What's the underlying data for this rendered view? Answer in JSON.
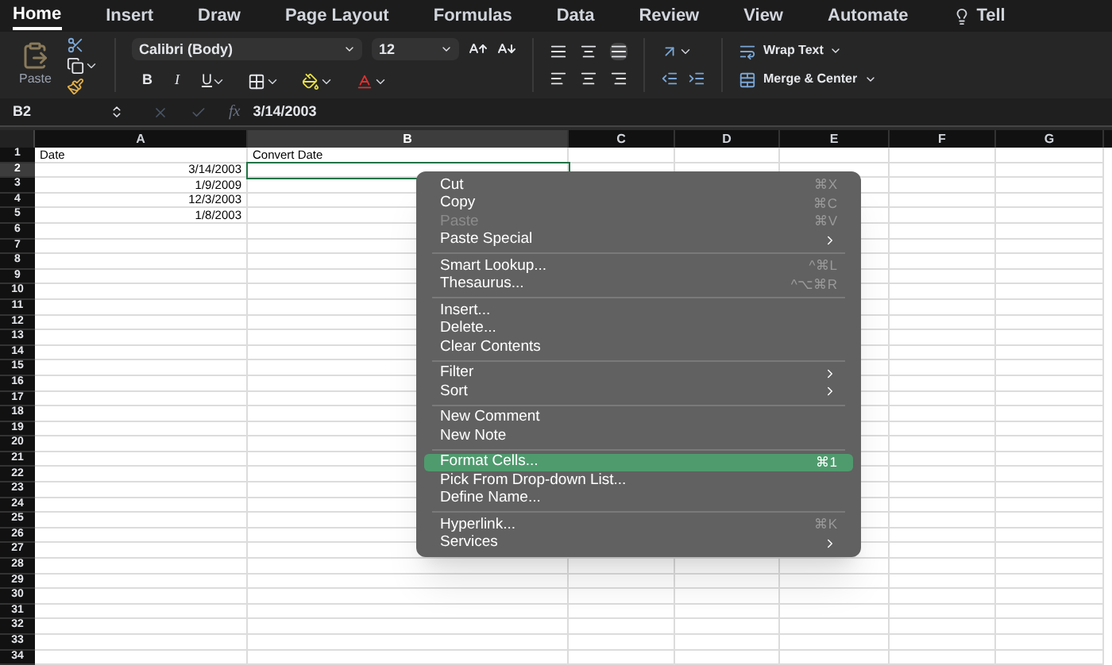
{
  "ribbon_tabs": [
    {
      "label": "Home",
      "selected": true
    },
    {
      "label": "Insert",
      "selected": false
    },
    {
      "label": "Draw",
      "selected": false
    },
    {
      "label": "Page Layout",
      "selected": false
    },
    {
      "label": "Formulas",
      "selected": false
    },
    {
      "label": "Data",
      "selected": false
    },
    {
      "label": "Review",
      "selected": false
    },
    {
      "label": "View",
      "selected": false
    },
    {
      "label": "Automate",
      "selected": false
    },
    {
      "label": "Tell",
      "selected": false
    }
  ],
  "ribbon": {
    "paste_label": "Paste",
    "font_name": "Calibri (Body)",
    "font_size": "12",
    "bold": "B",
    "italic": "I",
    "underline": "U",
    "wrap_text": "Wrap Text",
    "merge_center": "Merge & Center"
  },
  "formula_bar": {
    "cell_ref": "B2",
    "function_label": "fx",
    "value": "3/14/2003"
  },
  "sheet": {
    "columns": [
      {
        "label": "A",
        "selected": false
      },
      {
        "label": "B",
        "selected": true
      },
      {
        "label": "C",
        "selected": false
      },
      {
        "label": "D",
        "selected": false
      },
      {
        "label": "E",
        "selected": false
      },
      {
        "label": "F",
        "selected": false
      },
      {
        "label": "G",
        "selected": false
      }
    ],
    "rows": [
      {
        "label": "1",
        "selected": false,
        "cells": [
          {
            "text": "Date",
            "kind": "text",
            "selected": false
          },
          {
            "text": "Convert Date",
            "kind": "text",
            "selected": false
          }
        ]
      },
      {
        "label": "2",
        "selected": true,
        "cells": [
          {
            "text": "3/14/2003",
            "kind": "number",
            "selected": false
          },
          {
            "kind": "number",
            "selected": true
          }
        ]
      },
      {
        "label": "3",
        "selected": false,
        "cells": [
          {
            "text": "1/9/2009",
            "kind": "number",
            "selected": false
          }
        ]
      },
      {
        "label": "4",
        "selected": false,
        "cells": [
          {
            "text": "12/3/2003",
            "kind": "number",
            "selected": false
          }
        ]
      },
      {
        "label": "5",
        "selected": false,
        "cells": [
          {
            "text": "1/8/2003",
            "kind": "number",
            "selected": false
          }
        ]
      },
      {
        "label": "6",
        "selected": false
      },
      {
        "label": "7",
        "selected": false
      },
      {
        "label": "8",
        "selected": false
      },
      {
        "label": "9",
        "selected": false
      },
      {
        "label": "10",
        "selected": false
      },
      {
        "label": "11",
        "selected": false
      },
      {
        "label": "12",
        "selected": false
      },
      {
        "label": "13",
        "selected": false
      },
      {
        "label": "14",
        "selected": false
      },
      {
        "label": "15",
        "selected": false
      },
      {
        "label": "16",
        "selected": false
      },
      {
        "label": "17",
        "selected": false
      },
      {
        "label": "18",
        "selected": false
      },
      {
        "label": "19",
        "selected": false
      },
      {
        "label": "20",
        "selected": false
      },
      {
        "label": "21",
        "selected": false
      },
      {
        "label": "22",
        "selected": false
      },
      {
        "label": "23",
        "selected": false
      },
      {
        "label": "24",
        "selected": false
      },
      {
        "label": "25",
        "selected": false
      },
      {
        "label": "26",
        "selected": false
      },
      {
        "label": "27",
        "selected": false
      },
      {
        "label": "28",
        "selected": false
      },
      {
        "label": "29",
        "selected": false
      },
      {
        "label": "30",
        "selected": false
      },
      {
        "label": "31",
        "selected": false
      },
      {
        "label": "32",
        "selected": false
      },
      {
        "label": "33",
        "selected": false
      },
      {
        "label": "34",
        "selected": false
      }
    ]
  },
  "context_menu": [
    {
      "kind": "item",
      "label": "Cut",
      "shortcut": "⌘X",
      "disabled": false,
      "submenu": false,
      "selected": false
    },
    {
      "kind": "item",
      "label": "Copy",
      "shortcut": "⌘C",
      "disabled": false,
      "submenu": false,
      "selected": false
    },
    {
      "kind": "item",
      "label": "Paste",
      "shortcut": "⌘V",
      "disabled": true,
      "submenu": false,
      "selected": false
    },
    {
      "kind": "item",
      "label": "Paste Special",
      "disabled": false,
      "submenu": true,
      "selected": false
    },
    {
      "kind": "separator"
    },
    {
      "kind": "item",
      "label": "Smart Lookup...",
      "shortcut": "^⌘L",
      "disabled": false,
      "submenu": false,
      "selected": false
    },
    {
      "kind": "item",
      "label": "Thesaurus...",
      "shortcut": "^⌥⌘R",
      "disabled": false,
      "submenu": false,
      "selected": false
    },
    {
      "kind": "separator"
    },
    {
      "kind": "item",
      "label": "Insert...",
      "disabled": false,
      "submenu": false,
      "selected": false
    },
    {
      "kind": "item",
      "label": "Delete...",
      "disabled": false,
      "submenu": false,
      "selected": false
    },
    {
      "kind": "item",
      "label": "Clear Contents",
      "disabled": false,
      "submenu": false,
      "selected": false
    },
    {
      "kind": "separator"
    },
    {
      "kind": "item",
      "label": "Filter",
      "disabled": false,
      "submenu": true,
      "selected": false
    },
    {
      "kind": "item",
      "label": "Sort",
      "disabled": false,
      "submenu": true,
      "selected": false
    },
    {
      "kind": "separator"
    },
    {
      "kind": "item",
      "label": "New Comment",
      "disabled": false,
      "submenu": false,
      "selected": false
    },
    {
      "kind": "item",
      "label": "New Note",
      "disabled": false,
      "submenu": false,
      "selected": false
    },
    {
      "kind": "separator"
    },
    {
      "kind": "item",
      "label": "Format Cells...",
      "shortcut": "⌘1",
      "disabled": false,
      "submenu": false,
      "selected": true
    },
    {
      "kind": "item",
      "label": "Pick From Drop-down List...",
      "disabled": false,
      "submenu": false,
      "selected": false
    },
    {
      "kind": "item",
      "label": "Define Name...",
      "disabled": false,
      "submenu": false,
      "selected": false
    },
    {
      "kind": "separator"
    },
    {
      "kind": "item",
      "label": "Hyperlink...",
      "shortcut": "⌘K",
      "disabled": false,
      "submenu": false,
      "selected": false
    },
    {
      "kind": "item",
      "label": "Services",
      "disabled": false,
      "submenu": true,
      "selected": false
    }
  ]
}
